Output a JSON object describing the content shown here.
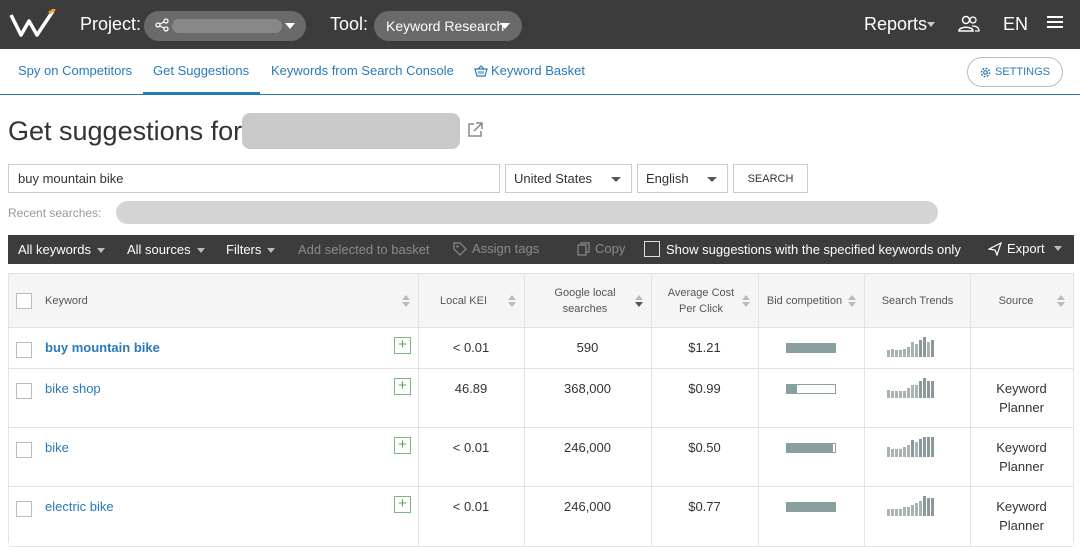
{
  "topbar": {
    "project_label": "Project:",
    "tool_label": "Tool:",
    "tool_value": "Keyword Research",
    "reports": "Reports",
    "language": "EN"
  },
  "subnav": {
    "items": [
      "Spy on Competitors",
      "Get Suggestions",
      "Keywords from Search Console",
      "Keyword Basket"
    ],
    "active_index": 1,
    "settings": "SETTINGS"
  },
  "heading": {
    "title": "Get suggestions for"
  },
  "search": {
    "keyword": "buy mountain bike",
    "country": "United States",
    "language": "English",
    "button": "SEARCH",
    "recent_label": "Recent searches:"
  },
  "toolbar": {
    "all_keywords": "All keywords",
    "all_sources": "All sources",
    "filters": "Filters",
    "add_to_basket": "Add selected to basket",
    "assign_tags": "Assign tags",
    "copy": "Copy",
    "show_specified": "Show suggestions with the specified keywords only",
    "export": "Export"
  },
  "table": {
    "columns": [
      "Keyword",
      "Local KEI",
      "Google local searches",
      "Average Cost Per Click",
      "Bid competition",
      "Search Trends",
      "Source"
    ],
    "sorted_column": "Google local searches",
    "rows": [
      {
        "keyword": "buy mountain bike",
        "bold": true,
        "kei": "< 0.01",
        "searches": "590",
        "cpc": "$1.21",
        "bid": 1.0,
        "source": "",
        "trend": [
          4,
          5,
          4,
          4,
          5,
          6,
          9,
          8,
          10,
          12,
          9,
          10
        ]
      },
      {
        "keyword": "bike shop",
        "bold": false,
        "kei": "46.89",
        "searches": "368,000",
        "cpc": "$0.99",
        "bid": 0.2,
        "source": "Keyword Planner",
        "trend": [
          5,
          4,
          4,
          4,
          4,
          6,
          8,
          8,
          10,
          12,
          10,
          10
        ]
      },
      {
        "keyword": "bike",
        "bold": false,
        "kei": "< 0.01",
        "searches": "246,000",
        "cpc": "$0.50",
        "bid": 0.95,
        "source": "Keyword Planner",
        "trend": [
          6,
          5,
          5,
          5,
          6,
          7,
          10,
          9,
          11,
          12,
          12,
          12
        ]
      },
      {
        "keyword": "electric bike",
        "bold": false,
        "kei": "< 0.01",
        "searches": "246,000",
        "cpc": "$0.77",
        "bid": 1.0,
        "source": "Keyword Planner",
        "trend": [
          4,
          4,
          4,
          4,
          5,
          5,
          6,
          7,
          8,
          11,
          10,
          10
        ]
      }
    ]
  },
  "colors": {
    "accent": "#2a7ab8",
    "topbar": "#3c3c3c",
    "add": "#5aa55a",
    "bid": "#8aa0a0"
  }
}
